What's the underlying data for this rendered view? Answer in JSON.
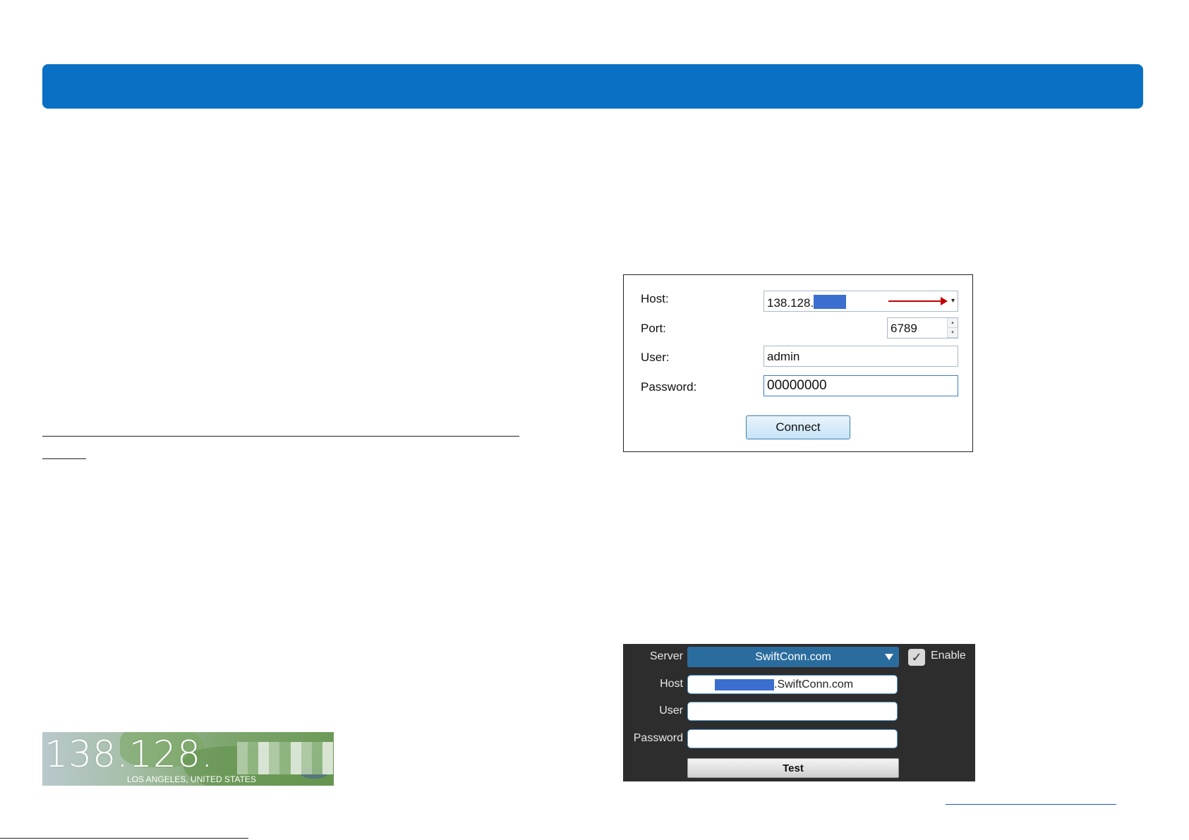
{
  "colors": {
    "header_bar": "#0a70c4",
    "host_mask": "#3a6fd0",
    "annotation_arrow": "#c00000",
    "dark_panel": "#2d2d2d",
    "server_select": "#2b6c9e"
  },
  "ip_card": {
    "ip_visible": "138.128.",
    "location": "LOS ANGELES, UNITED STATES"
  },
  "login_dialog": {
    "host_label": "Host:",
    "host_value": "138.128.",
    "port_label": "Port:",
    "port_value": "6789",
    "user_label": "User:",
    "user_value": "admin",
    "password_label": "Password:",
    "password_value": "00000000",
    "connect_label": "Connect",
    "spin_up": "▴",
    "spin_down": "▾",
    "dropdown_glyph": "▾"
  },
  "ddns_panel": {
    "server_label": "Server",
    "server_value": "SwiftConn.com",
    "enable_label": "Enable",
    "enable_checked_glyph": "✓",
    "host_label": "Host",
    "host_value": ".SwiftConn.com",
    "user_label": "User",
    "password_label": "Password",
    "test_label": "Test"
  }
}
